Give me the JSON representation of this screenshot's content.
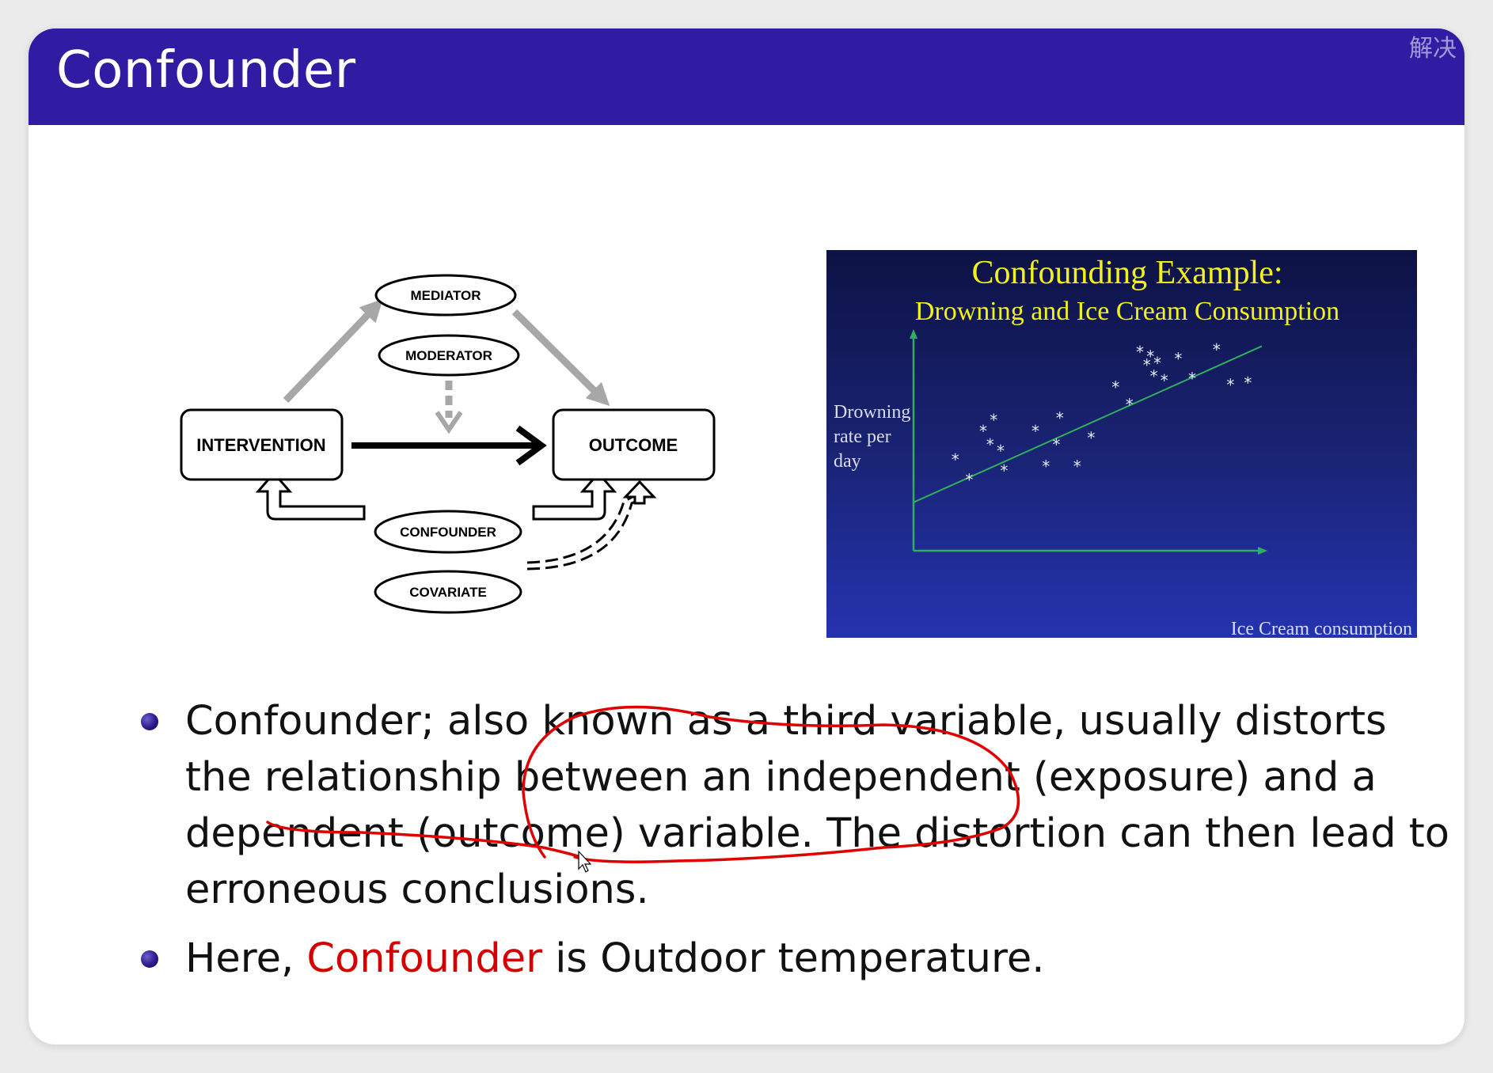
{
  "slide": {
    "title": "Confounder",
    "corner_text": "解决",
    "colors": {
      "title_bar": "#2f1ca3",
      "chart_background": "#1d2a86",
      "chart_title": "#f2f21a",
      "fit_line": "#2fae5c",
      "annotation": "#e00000",
      "highlight_word": "#d40000"
    }
  },
  "diagram": {
    "nodes": {
      "mediator": "MEDIATOR",
      "moderator": "MODERATOR",
      "intervention": "INTERVENTION",
      "outcome": "OUTCOME",
      "confounder": "CONFOUNDER",
      "covariate": "COVARIATE"
    }
  },
  "chart_data": {
    "type": "scatter",
    "title": "Confounding Example:",
    "subtitle": "Drowning and Ice Cream Consumption",
    "ylabel_lines": [
      "Drowning",
      "rate per",
      "day"
    ],
    "xlabel": "Ice Cream consumption",
    "xlim": [
      0,
      100
    ],
    "ylim": [
      0,
      100
    ],
    "grid": false,
    "marker": "*",
    "points": [
      [
        12,
        42
      ],
      [
        16,
        33
      ],
      [
        20,
        55
      ],
      [
        22,
        49
      ],
      [
        23,
        60
      ],
      [
        25,
        46
      ],
      [
        26,
        37
      ],
      [
        35,
        55
      ],
      [
        38,
        39
      ],
      [
        41,
        49
      ],
      [
        42,
        61
      ],
      [
        47,
        39
      ],
      [
        51,
        52
      ],
      [
        58,
        75
      ],
      [
        62,
        67
      ],
      [
        65,
        91
      ],
      [
        67,
        85
      ],
      [
        68,
        89
      ],
      [
        69,
        80
      ],
      [
        70,
        86
      ],
      [
        72,
        78
      ],
      [
        76,
        88
      ],
      [
        80,
        79
      ],
      [
        87,
        92
      ],
      [
        91,
        76
      ],
      [
        96,
        77
      ]
    ],
    "fit_line": {
      "x": [
        0,
        100
      ],
      "y": [
        22,
        93
      ]
    }
  },
  "bullets": {
    "b1": "Confounder; also known as a third variable, usually distorts the relationship between an independent (exposure) and a dependent (outcome) variable. The distortion can then lead to erroneous conclusions.",
    "b2_prefix": "Here, ",
    "b2_highlight": "Confounder",
    "b2_mid": " is ",
    "b2_suffix": "Outdoor temperature."
  }
}
